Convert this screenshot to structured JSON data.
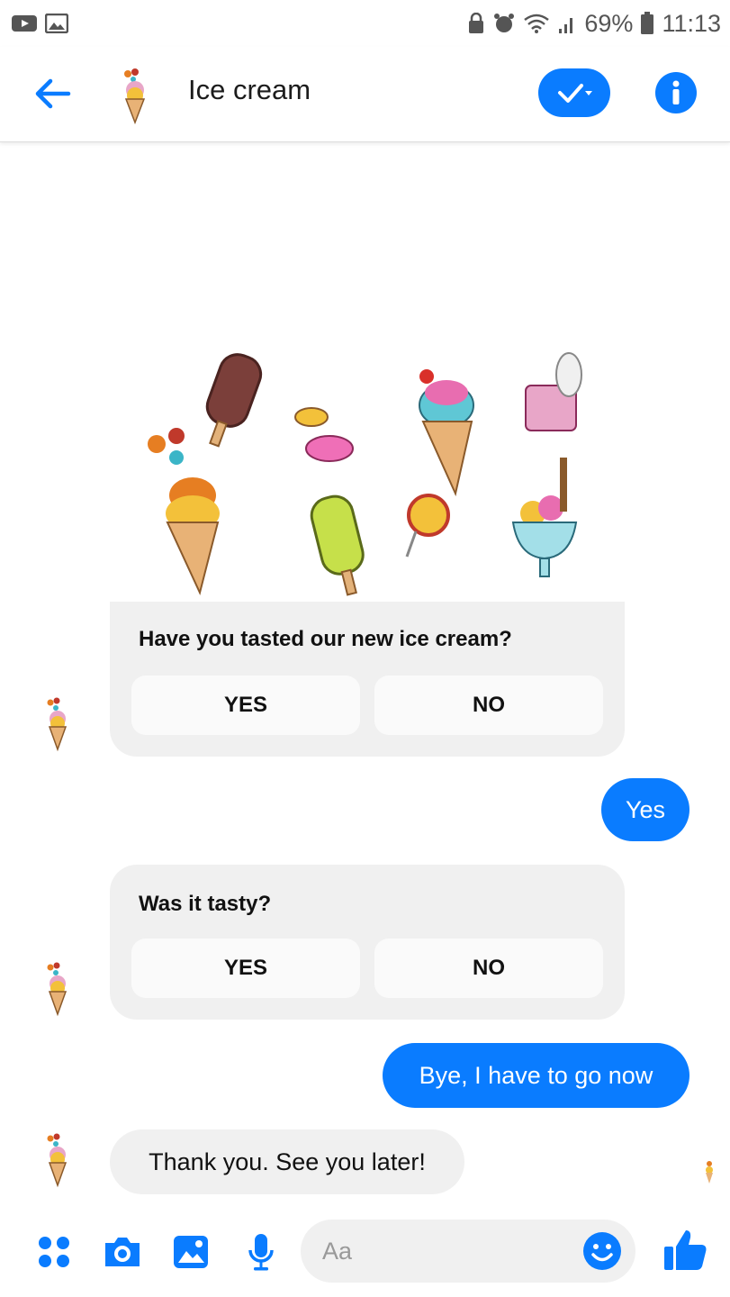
{
  "status_bar": {
    "battery": "69%",
    "time": "11:13"
  },
  "header": {
    "title": "Ice cream"
  },
  "messages": {
    "card1": {
      "question": "Have you tasted our new ice cream?",
      "buttons": [
        "YES",
        "NO"
      ]
    },
    "reply1": "Yes",
    "card2": {
      "question": "Was it tasty?",
      "buttons": [
        "YES",
        "NO"
      ]
    },
    "reply2": "Bye, I have to go now",
    "bot_reply": "Thank you. See you later!"
  },
  "composer": {
    "placeholder": "Aa"
  },
  "colors": {
    "accent": "#0a7cff",
    "bubble_in": "#f0f0f0"
  },
  "icons": [
    "youtube-icon",
    "gallery-icon",
    "lock-icon",
    "alarm-icon",
    "wifi-icon",
    "signal-icon",
    "battery-icon",
    "back-arrow-icon",
    "check-icon",
    "info-icon",
    "apps-icon",
    "camera-icon",
    "photo-icon",
    "microphone-icon",
    "emoji-icon",
    "thumbs-up-icon"
  ]
}
